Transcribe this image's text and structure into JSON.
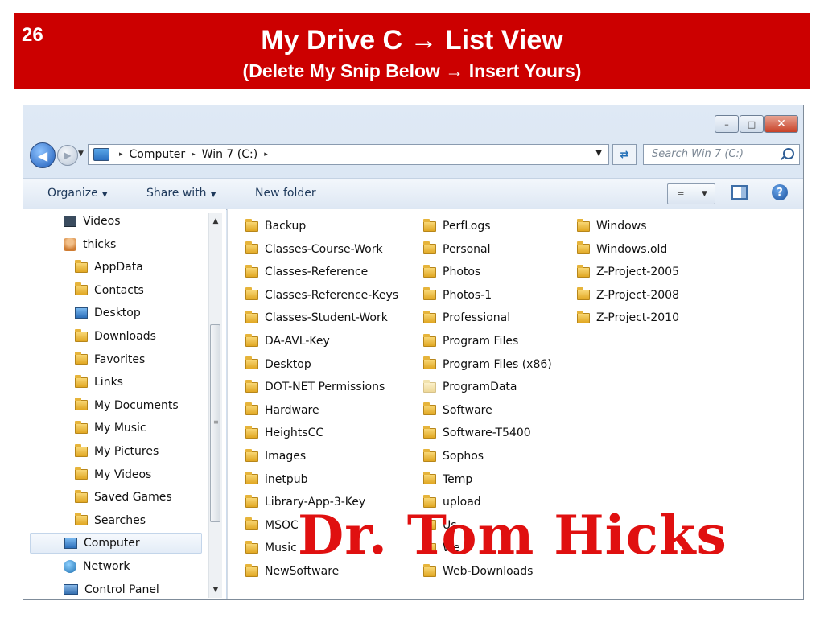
{
  "slide": {
    "number": "26",
    "title": "My Drive C → List View",
    "subtitle": "(Delete My Snip Below → Insert Yours)",
    "banner_color": "#cc0000"
  },
  "window": {
    "controls": {
      "minimize": "–",
      "maximize": "□",
      "close": "✕"
    },
    "address": {
      "segments": [
        "Computer",
        "Win 7 (C:)"
      ],
      "separator": "▸"
    },
    "search": {
      "placeholder": "Search Win 7 (C:)"
    },
    "toolbar": {
      "organize": "Organize",
      "share_with": "Share with",
      "new_folder": "New folder",
      "caret": "▼",
      "help": "?"
    },
    "nav": [
      {
        "label": "Videos",
        "icon": "video-library-icon"
      },
      {
        "label": "thicks",
        "icon": "user-folder-icon"
      },
      {
        "label": "AppData",
        "icon": "folder-icon"
      },
      {
        "label": "Contacts",
        "icon": "contacts-icon"
      },
      {
        "label": "Desktop",
        "icon": "desktop-icon"
      },
      {
        "label": "Downloads",
        "icon": "downloads-icon"
      },
      {
        "label": "Favorites",
        "icon": "favorites-icon"
      },
      {
        "label": "Links",
        "icon": "links-icon"
      },
      {
        "label": "My Documents",
        "icon": "documents-icon"
      },
      {
        "label": "My Music",
        "icon": "music-icon"
      },
      {
        "label": "My Pictures",
        "icon": "pictures-icon"
      },
      {
        "label": "My Videos",
        "icon": "videos-icon"
      },
      {
        "label": "Saved Games",
        "icon": "saved-games-icon"
      },
      {
        "label": "Searches",
        "icon": "searches-icon"
      },
      {
        "label": "Computer",
        "icon": "computer-icon",
        "selected": true
      },
      {
        "label": "Network",
        "icon": "network-icon"
      },
      {
        "label": "Control Panel",
        "icon": "control-panel-icon"
      }
    ],
    "files": {
      "column1": [
        "Backup",
        "Classes-Course-Work",
        "Classes-Reference",
        "Classes-Reference-Keys",
        "Classes-Student-Work",
        "DA-AVL-Key",
        "Desktop",
        "DOT-NET Permissions",
        "Hardware",
        "HeightsCC",
        "Images",
        "inetpub",
        "Library-App-3-Key",
        "MSOC",
        "Music",
        "NewSoftware"
      ],
      "column2": [
        "PerfLogs",
        "Personal",
        "Photos",
        "Photos-1",
        "Professional",
        "Program Files",
        "Program Files (x86)",
        "ProgramData",
        "Software",
        "Software-T5400",
        "Sophos",
        "Temp",
        "upload",
        "Us",
        "We",
        "Web-Downloads"
      ],
      "column3": [
        "Windows",
        "Windows.old",
        "Z-Project-2005",
        "Z-Project-2008",
        "Z-Project-2010"
      ]
    }
  },
  "watermark": {
    "text": "Dr. Tom Hicks",
    "color": "#e01010"
  }
}
